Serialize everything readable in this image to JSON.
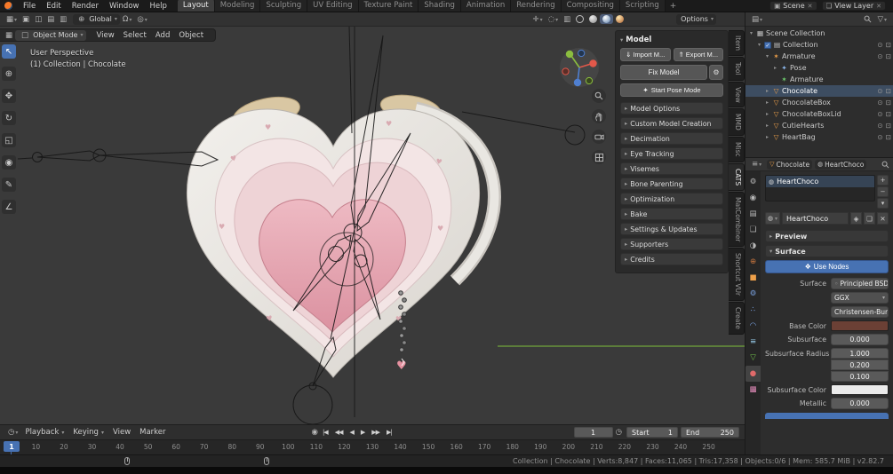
{
  "colors": {
    "accent_blue": "#4772b3",
    "object_orange": "#eea04a",
    "viewport_bg": "#3a3a3a"
  },
  "topbar": {
    "menus": [
      "File",
      "Edit",
      "Render",
      "Window",
      "Help"
    ],
    "workspaces": [
      "Layout",
      "Modeling",
      "Sculpting",
      "UV Editing",
      "Texture Paint",
      "Shading",
      "Animation",
      "Rendering",
      "Compositing",
      "Scripting"
    ],
    "active_workspace": "Layout",
    "add_label": "+",
    "scene_label": "Scene",
    "view_layer_label": "View Layer"
  },
  "viewport": {
    "header": {
      "orientation_label": "Global",
      "options_label": "Options"
    },
    "mode_bar": {
      "mode_label": "Object Mode",
      "menus": [
        "View",
        "Select",
        "Add",
        "Object"
      ]
    },
    "overlay": {
      "line1": "User Perspective",
      "line2": "(1) Collection | Chocolate"
    },
    "tools": [
      {
        "name": "tweak-select",
        "glyph": "↖",
        "active": true
      },
      {
        "name": "cursor",
        "glyph": "⊕"
      },
      {
        "name": "move",
        "glyph": "✥"
      },
      {
        "name": "rotate",
        "glyph": "↻"
      },
      {
        "name": "scale",
        "glyph": "◱"
      },
      {
        "name": "transform",
        "glyph": "◉"
      },
      {
        "name": "annotate",
        "glyph": "✎"
      },
      {
        "name": "measure",
        "glyph": "∠"
      }
    ]
  },
  "npanel": {
    "title": "Model",
    "import_label": "Import M...",
    "export_label": "Export M...",
    "fix_label": "Fix Model",
    "pose_label": "Start Pose Mode",
    "sections": [
      "Model Options",
      "Custom Model Creation",
      "Decimation",
      "Eye Tracking",
      "Visemes",
      "Bone Parenting",
      "Optimization",
      "Bake",
      "Settings & Updates",
      "Supporters",
      "Credits"
    ],
    "tabs": [
      "Item",
      "Tool",
      "View",
      "MMD",
      "Misc",
      "CATS",
      "MatCombiner",
      "Shortcut VUr",
      "Create"
    ],
    "active_tab": "CATS"
  },
  "outliner": {
    "root_label": "Scene Collection",
    "items": [
      {
        "label": "Collection",
        "depth": 1,
        "icon": "collection",
        "caret": "▾",
        "checkbox": true,
        "eye": true,
        "camera": true
      },
      {
        "label": "Armature",
        "depth": 2,
        "icon": "armature",
        "caret": "▾",
        "eye": true,
        "camera": true
      },
      {
        "label": "Pose",
        "depth": 3,
        "icon": "pose",
        "caret": "▸",
        "eye": false,
        "camera": false
      },
      {
        "label": "Armature",
        "depth": 3,
        "icon": "armature-data",
        "caret": "",
        "eye": false,
        "camera": false
      },
      {
        "label": "Chocolate",
        "depth": 2,
        "icon": "mesh",
        "caret": "▸",
        "selected": true,
        "eye": true,
        "camera": true
      },
      {
        "label": "ChocolateBox",
        "depth": 2,
        "icon": "mesh",
        "caret": "▸",
        "eye": true,
        "camera": true
      },
      {
        "label": "ChocolateBoxLid",
        "depth": 2,
        "icon": "mesh",
        "caret": "▸",
        "eye": true,
        "camera": true
      },
      {
        "label": "CutieHearts",
        "depth": 2,
        "icon": "mesh",
        "caret": "▸",
        "eye": true,
        "camera": true
      },
      {
        "label": "HeartBag",
        "depth": 2,
        "icon": "mesh",
        "caret": "▸",
        "eye": true,
        "camera": true
      }
    ]
  },
  "properties": {
    "breadcrumb_object": "Chocolate",
    "breadcrumb_material": "HeartChoco",
    "slot_name": "HeartChoco",
    "datablock_name": "HeartChoco",
    "preview_label": "Preview",
    "surface_panel_label": "Surface",
    "use_nodes_label": "Use Nodes",
    "surface_label": "Surface",
    "surface_value": "Principled BSDF",
    "distribution_value": "GGX",
    "sss_method_value": "Christensen-Burl...",
    "base_color_label": "Base Color",
    "base_color_hex": "#6b4035",
    "subsurface_label": "Subsurface",
    "subsurface_value": "0.000",
    "radius_label": "Subsurface Radius",
    "radius_values": [
      "1.000",
      "0.200",
      "0.100"
    ],
    "sss_color_label": "Subsurface Color",
    "sss_color_hex": "#ebebeb",
    "metallic_label": "Metallic",
    "metallic_value": "0.000",
    "tab_icons": [
      {
        "name": "active-tool",
        "glyph": "⚙",
        "color": "#b8b8b8"
      },
      {
        "name": "render",
        "glyph": "◉",
        "color": "#b8b8b8"
      },
      {
        "name": "output",
        "glyph": "▤",
        "color": "#b8b8b8"
      },
      {
        "name": "view-layer",
        "glyph": "❏",
        "color": "#b8b8b8"
      },
      {
        "name": "scene",
        "glyph": "◑",
        "color": "#b8b8b8"
      },
      {
        "name": "world",
        "glyph": "⊕",
        "color": "#c9763f"
      },
      {
        "name": "object",
        "glyph": "■",
        "color": "#eea04a"
      },
      {
        "name": "modifiers",
        "glyph": "⚙",
        "color": "#7aa2e0"
      },
      {
        "name": "particles",
        "glyph": "∴",
        "color": "#7aa2e0"
      },
      {
        "name": "physics",
        "glyph": "◠",
        "color": "#7aa2e0"
      },
      {
        "name": "constraints",
        "glyph": "≡",
        "color": "#9ad0f0"
      },
      {
        "name": "object-data",
        "glyph": "▽",
        "color": "#74c74c"
      },
      {
        "name": "material",
        "glyph": "●",
        "color": "#e06a6a",
        "active": true
      },
      {
        "name": "texture",
        "glyph": "▩",
        "color": "#e08ab8"
      }
    ]
  },
  "timeline": {
    "menus": [
      {
        "label": "Playback",
        "caret": true
      },
      {
        "label": "Keying",
        "caret": true
      },
      {
        "label": "View",
        "caret": false
      },
      {
        "label": "Marker",
        "caret": false
      }
    ],
    "record_glyph": "◉",
    "transport": [
      {
        "name": "jump-to-start",
        "glyph": "|◀"
      },
      {
        "name": "prev-keyframe",
        "glyph": "◀◀"
      },
      {
        "name": "play-reverse",
        "glyph": "◀"
      },
      {
        "name": "play",
        "glyph": "▶"
      },
      {
        "name": "next-keyframe",
        "glyph": "▶▶"
      },
      {
        "name": "jump-to-end",
        "glyph": "▶|"
      }
    ],
    "current_frame": "1",
    "preview_range_glyph": "◷",
    "start_label": "Start",
    "start_value": "1",
    "end_label": "End",
    "end_value": "250",
    "ruler": [
      1,
      10,
      20,
      30,
      40,
      50,
      60,
      70,
      80,
      90,
      100,
      110,
      120,
      130,
      140,
      150,
      160,
      170,
      180,
      190,
      200,
      210,
      220,
      230,
      240,
      250
    ]
  },
  "statusbar": {
    "stats": "Collection | Chocolate | Verts:8,847 | Faces:11,065 | Tris:17,358 | Objects:0/6 | Mem: 585.7 MiB | v2.82.7"
  }
}
